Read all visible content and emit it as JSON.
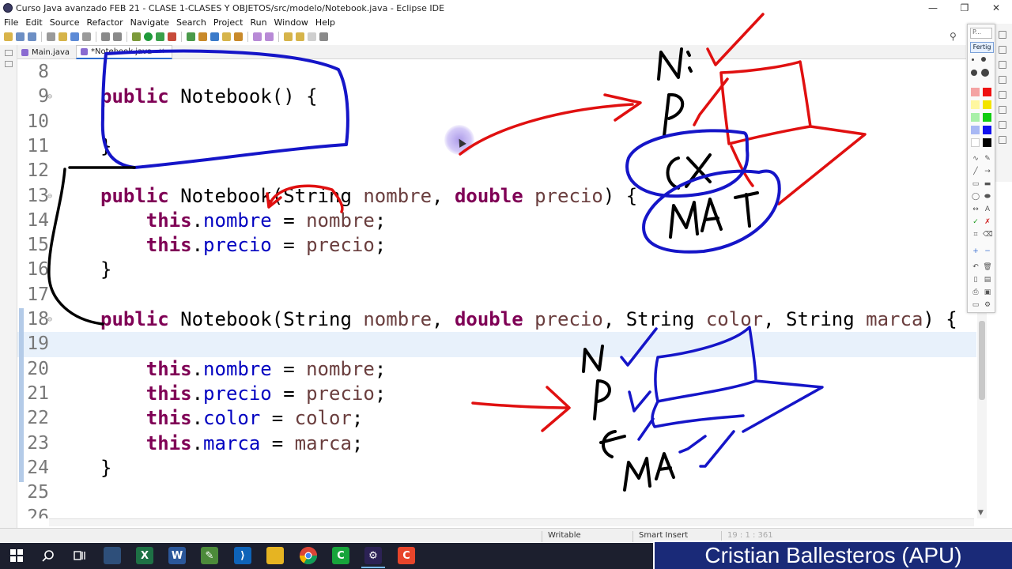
{
  "window": {
    "title": "Curso Java avanzado FEB 21 - CLASE 1-CLASES Y OBJETOS/src/modelo/Notebook.java - Eclipse IDE",
    "controls": [
      "—",
      "❐",
      "✕"
    ]
  },
  "menu": [
    "File",
    "Edit",
    "Source",
    "Refactor",
    "Navigate",
    "Search",
    "Project",
    "Run",
    "Window",
    "Help"
  ],
  "tabs": [
    {
      "label": "Main.java",
      "active": false
    },
    {
      "label": "*Notebook.java",
      "active": true,
      "close": "✕"
    }
  ],
  "editor": {
    "lines": [
      {
        "n": "8",
        "parts": []
      },
      {
        "n": "9",
        "fold": "⊖",
        "parts": [
          [
            "kw",
            "public"
          ],
          [
            "pl",
            " Notebook() {"
          ]
        ]
      },
      {
        "n": "10",
        "parts": []
      },
      {
        "n": "11",
        "parts": [
          [
            "pl",
            "}"
          ]
        ]
      },
      {
        "n": "12",
        "parts": []
      },
      {
        "n": "13",
        "fold": "⊖",
        "parts": [
          [
            "kw",
            "public"
          ],
          [
            "pl",
            " Notebook(String "
          ],
          [
            "par",
            "nombre"
          ],
          [
            "pl",
            ", "
          ],
          [
            "kw",
            "double"
          ],
          [
            "pl",
            " "
          ],
          [
            "par",
            "precio"
          ],
          [
            "pl",
            ") {"
          ]
        ]
      },
      {
        "n": "14",
        "parts": [
          [
            "pl",
            "    "
          ],
          [
            "kw",
            "this"
          ],
          [
            "pl",
            "."
          ],
          [
            "fld",
            "nombre"
          ],
          [
            "pl",
            " = "
          ],
          [
            "par",
            "nombre"
          ],
          [
            "pl",
            ";"
          ]
        ]
      },
      {
        "n": "15",
        "parts": [
          [
            "pl",
            "    "
          ],
          [
            "kw",
            "this"
          ],
          [
            "pl",
            "."
          ],
          [
            "fld",
            "precio"
          ],
          [
            "pl",
            " = "
          ],
          [
            "par",
            "precio"
          ],
          [
            "pl",
            ";"
          ]
        ]
      },
      {
        "n": "16",
        "parts": [
          [
            "pl",
            "}"
          ]
        ]
      },
      {
        "n": "17",
        "parts": []
      },
      {
        "n": "18",
        "fold": "⊖",
        "parts": [
          [
            "kw",
            "public"
          ],
          [
            "pl",
            " Notebook(String "
          ],
          [
            "par",
            "nombre"
          ],
          [
            "pl",
            ", "
          ],
          [
            "kw",
            "double"
          ],
          [
            "pl",
            " "
          ],
          [
            "par",
            "precio"
          ],
          [
            "pl",
            ", String "
          ],
          [
            "par",
            "color"
          ],
          [
            "pl",
            ", String "
          ],
          [
            "par",
            "marca"
          ],
          [
            "pl",
            ") {"
          ]
        ]
      },
      {
        "n": "19",
        "highlight": true,
        "parts": []
      },
      {
        "n": "20",
        "parts": [
          [
            "pl",
            "    "
          ],
          [
            "kw",
            "this"
          ],
          [
            "pl",
            "."
          ],
          [
            "fld",
            "nombre"
          ],
          [
            "pl",
            " = "
          ],
          [
            "par",
            "nombre"
          ],
          [
            "pl",
            ";"
          ]
        ]
      },
      {
        "n": "21",
        "parts": [
          [
            "pl",
            "    "
          ],
          [
            "kw",
            "this"
          ],
          [
            "pl",
            "."
          ],
          [
            "fld",
            "precio"
          ],
          [
            "pl",
            " = "
          ],
          [
            "par",
            "precio"
          ],
          [
            "pl",
            ";"
          ]
        ]
      },
      {
        "n": "22",
        "parts": [
          [
            "pl",
            "    "
          ],
          [
            "kw",
            "this"
          ],
          [
            "pl",
            "."
          ],
          [
            "fld",
            "color"
          ],
          [
            "pl",
            " = "
          ],
          [
            "par",
            "color"
          ],
          [
            "pl",
            ";"
          ]
        ]
      },
      {
        "n": "23",
        "parts": [
          [
            "pl",
            "    "
          ],
          [
            "kw",
            "this"
          ],
          [
            "pl",
            "."
          ],
          [
            "fld",
            "marca"
          ],
          [
            "pl",
            " = "
          ],
          [
            "par",
            "marca"
          ],
          [
            "pl",
            ";"
          ]
        ]
      },
      {
        "n": "24",
        "parts": [
          [
            "pl",
            "}"
          ]
        ]
      },
      {
        "n": "25",
        "parts": []
      },
      {
        "n": "26",
        "parts": []
      }
    ]
  },
  "status": {
    "writable": "Writable",
    "insert_mode": "Smart Insert",
    "position": "19 : 1 : 361"
  },
  "palette": {
    "input_value": "P...",
    "done_label": "Fertig"
  },
  "banner": {
    "text": "Cristian Ballesteros (APU)"
  },
  "taskbar": {
    "apps": [
      "start-icon",
      "search-icon",
      "task-view-icon",
      "app-icon",
      "excel-icon",
      "word-icon",
      "notepad-icon",
      "vscode-icon",
      "file-explorer-icon",
      "chrome-icon",
      "camtasia-icon",
      "eclipse-icon",
      "screen-recorder-icon"
    ]
  },
  "colors": {
    "keyword": "#7f0055",
    "field": "#0000c0",
    "parameter": "#6a3e3e",
    "ink_blue": "#1515c8",
    "ink_red": "#e01010",
    "ink_black": "#000000",
    "banner_bg": "#1a2a78"
  }
}
